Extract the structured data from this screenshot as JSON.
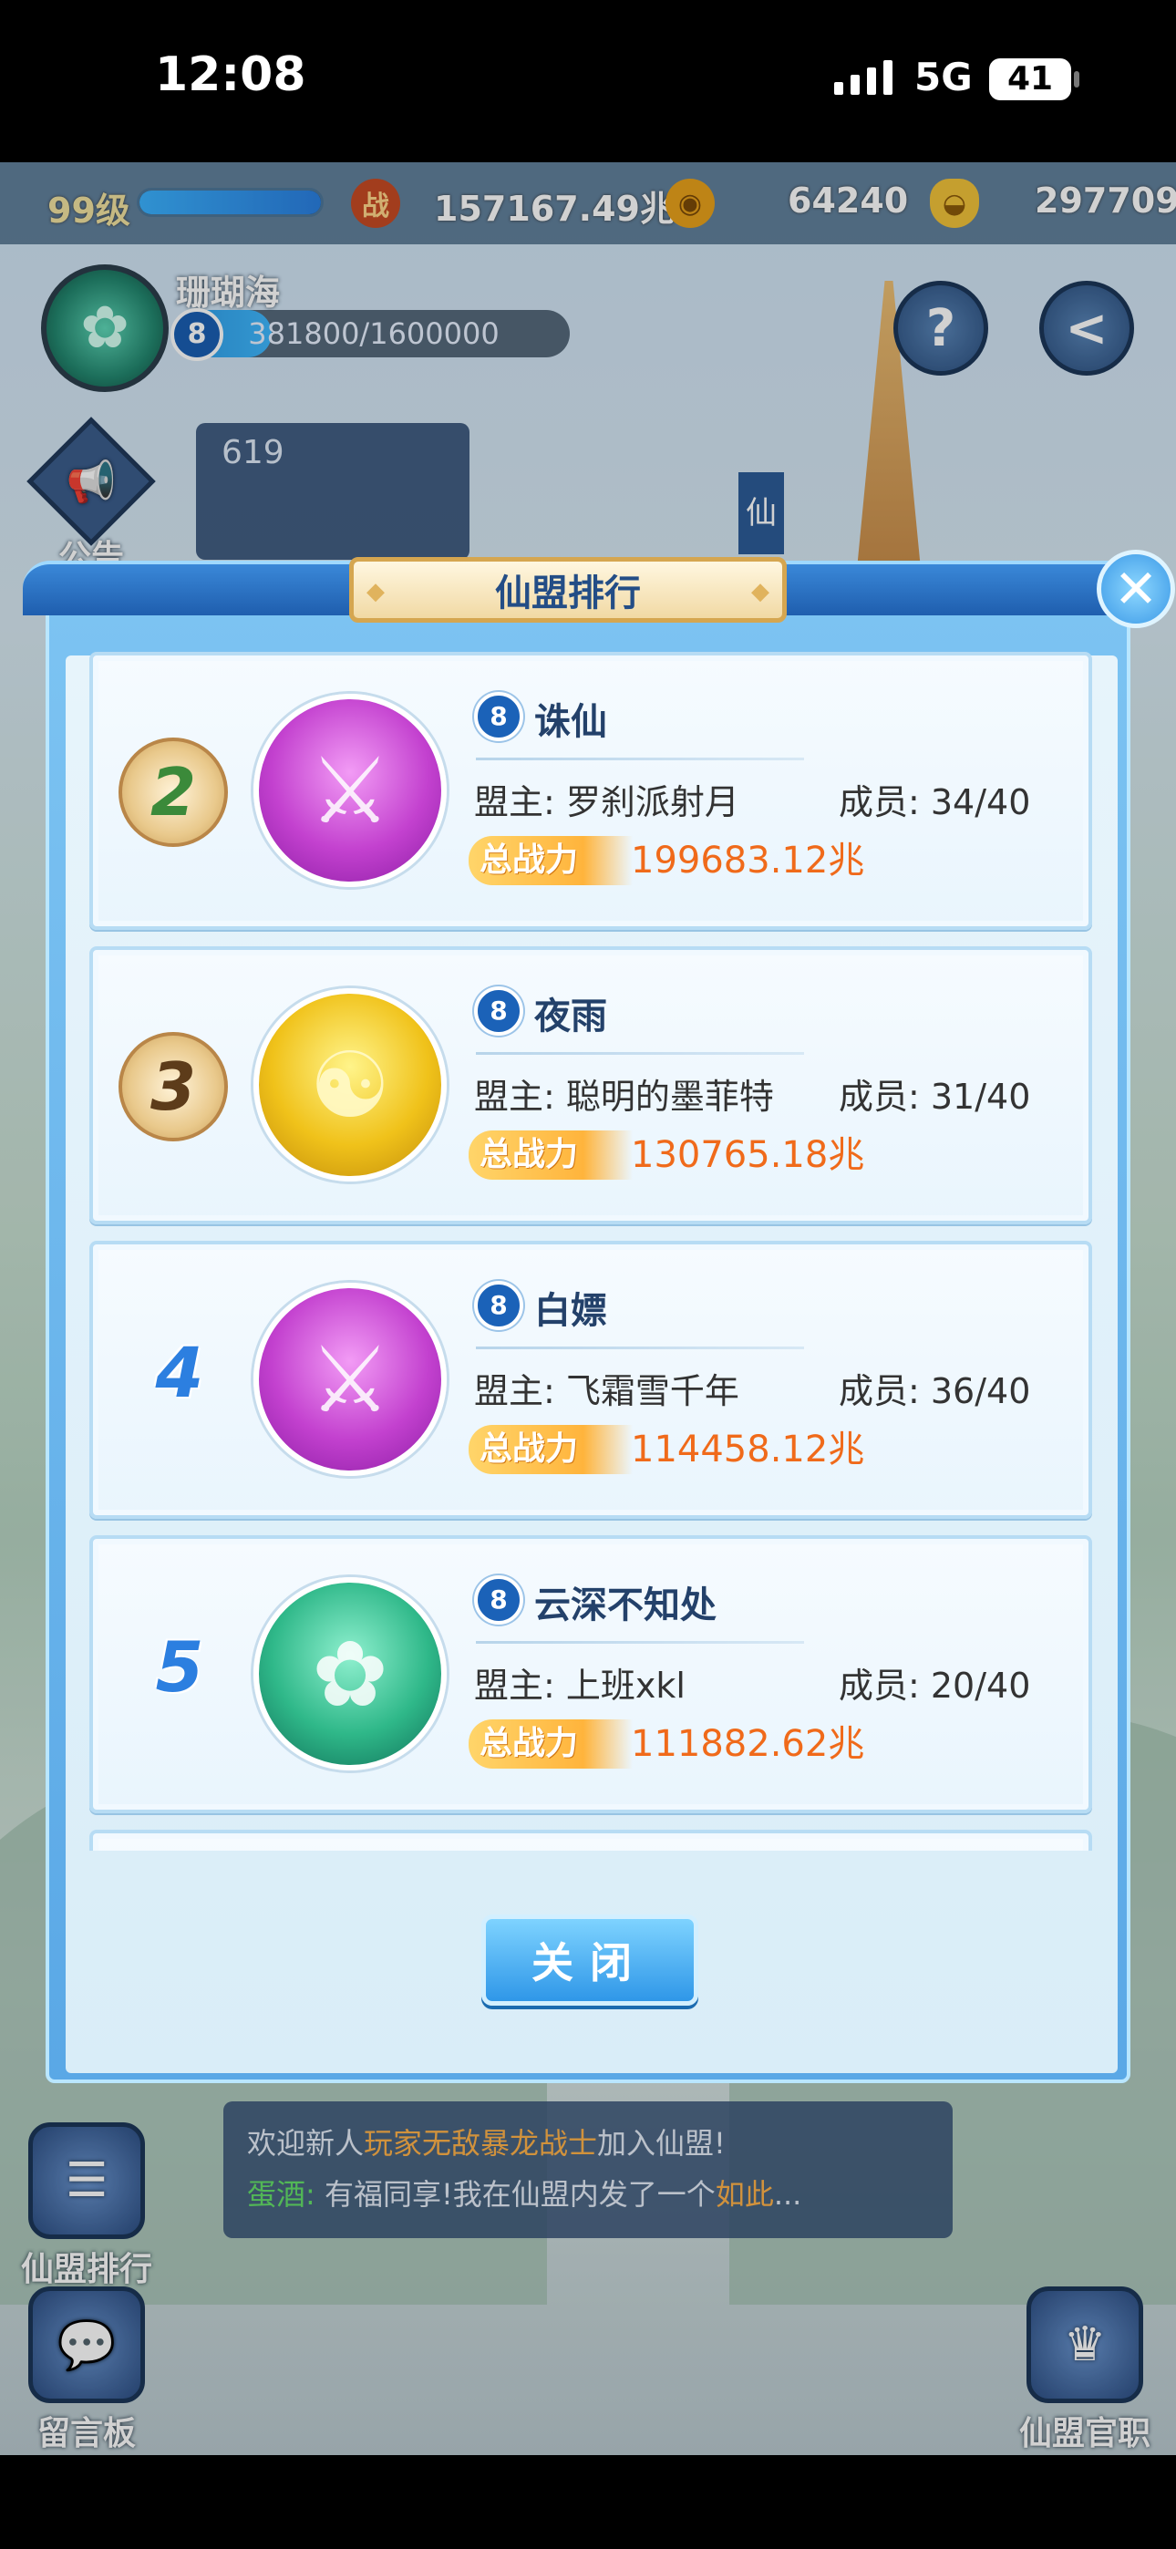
{
  "status_bar": {
    "time": "12:08",
    "network": "5G",
    "battery": "41"
  },
  "topbar": {
    "level": "99级",
    "level_progress": 1.0,
    "power_icon": "战",
    "power": "157167.49兆",
    "coin_icon": "coin-icon",
    "coins": "64240",
    "ingot_icon": "ingot-icon",
    "ingots": "297709"
  },
  "player": {
    "name": "珊瑚海",
    "guild_level": "8",
    "exp_text": "381800/1600000",
    "exp_progress": 0.239
  },
  "hud": {
    "help_label": "?",
    "back_label": "<",
    "notice_label": "公告",
    "chat_preview": "619",
    "immortal_flag": "仙"
  },
  "side_menus": {
    "ranking": "仙盟排行",
    "message_board": "留言板",
    "officials": "仙盟官职"
  },
  "bottom_chat": {
    "line1_prefix": "欢迎新人",
    "line1_player": "玩家无敌暴龙战士",
    "line1_suffix": "加入仙盟!",
    "line2_speaker": "蛋酒:",
    "line2_text": "有福同享!我在仙盟内发了一个",
    "line2_highlight": "如此",
    "line2_ellipsis": "..."
  },
  "modal": {
    "title": "仙盟排行",
    "close_symbol": "✕",
    "close_button_label": "关闭",
    "power_label": "总战力",
    "rows": [
      {
        "rank": "2",
        "rank_type": "medal",
        "emblem": "purple",
        "level": "8",
        "name": "诛仙",
        "leader": "盟主: 罗刹派射月",
        "members": "成员: 34/40",
        "power": "199683.12兆"
      },
      {
        "rank": "3",
        "rank_type": "medal",
        "emblem": "gold",
        "level": "8",
        "name": "夜雨",
        "leader": "盟主: 聪明的墨菲特",
        "members": "成员: 31/40",
        "power": "130765.18兆"
      },
      {
        "rank": "4",
        "rank_type": "number",
        "emblem": "purple",
        "level": "8",
        "name": "白嫖",
        "leader": "盟主: 飞霜雪千年",
        "members": "成员: 36/40",
        "power": "114458.12兆"
      },
      {
        "rank": "5",
        "rank_type": "number",
        "emblem": "teal",
        "level": "8",
        "name": "云深不知处",
        "leader": "盟主: 上班xkl",
        "members": "成员: 20/40",
        "power": "111882.62兆"
      }
    ]
  },
  "colors": {
    "accent": "#2f97e8",
    "power": "#f06a1a",
    "panel": "#e7f4fb"
  }
}
